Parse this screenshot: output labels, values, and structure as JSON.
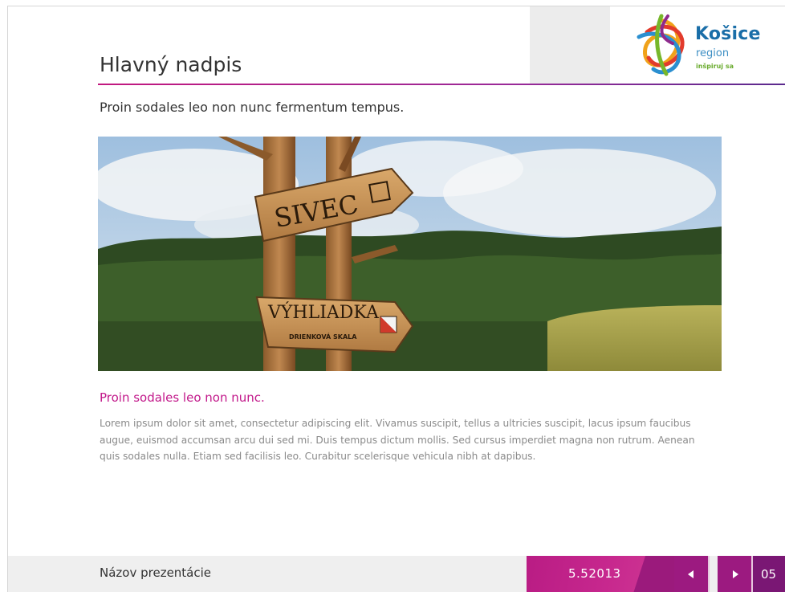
{
  "header": {
    "title": "Hlavný nadpis",
    "subtitle": "Proin sodales leo non nunc fermentum tempus.",
    "logo": {
      "name": "Košice",
      "sub": "region",
      "tagline": "inšpiruj sa"
    }
  },
  "photo": {
    "sign_top": "SIVEC",
    "sign_bottom_1": "VÝHLIADKA",
    "sign_bottom_2": "DRIENKOVÁ SKALA"
  },
  "content": {
    "heading": "Proin sodales leo non nunc.",
    "paragraph": "Lorem ipsum dolor sit amet, consectetur adipiscing elit. Vivamus suscipit, tellus a ultricies suscipit, lacus ipsum faucibus augue, euismod accumsan arcu dui sed mi. Duis tempus dictum mollis. Sed cursus imperdiet magna non rutrum. Aenean quis sodales nulla. Etiam sed facilisis leo. Curabitur scelerisque vehicula nibh at dapibus."
  },
  "footer": {
    "presentation_name": "Názov prezentácie",
    "date": "5.52013",
    "prev_icon": "triangle-left",
    "next_icon": "triangle-right",
    "page_number": "05"
  },
  "colors": {
    "accent": "#c2188a",
    "accent_dark": "#9c1a80",
    "logo_blue": "#1a6ea8"
  }
}
